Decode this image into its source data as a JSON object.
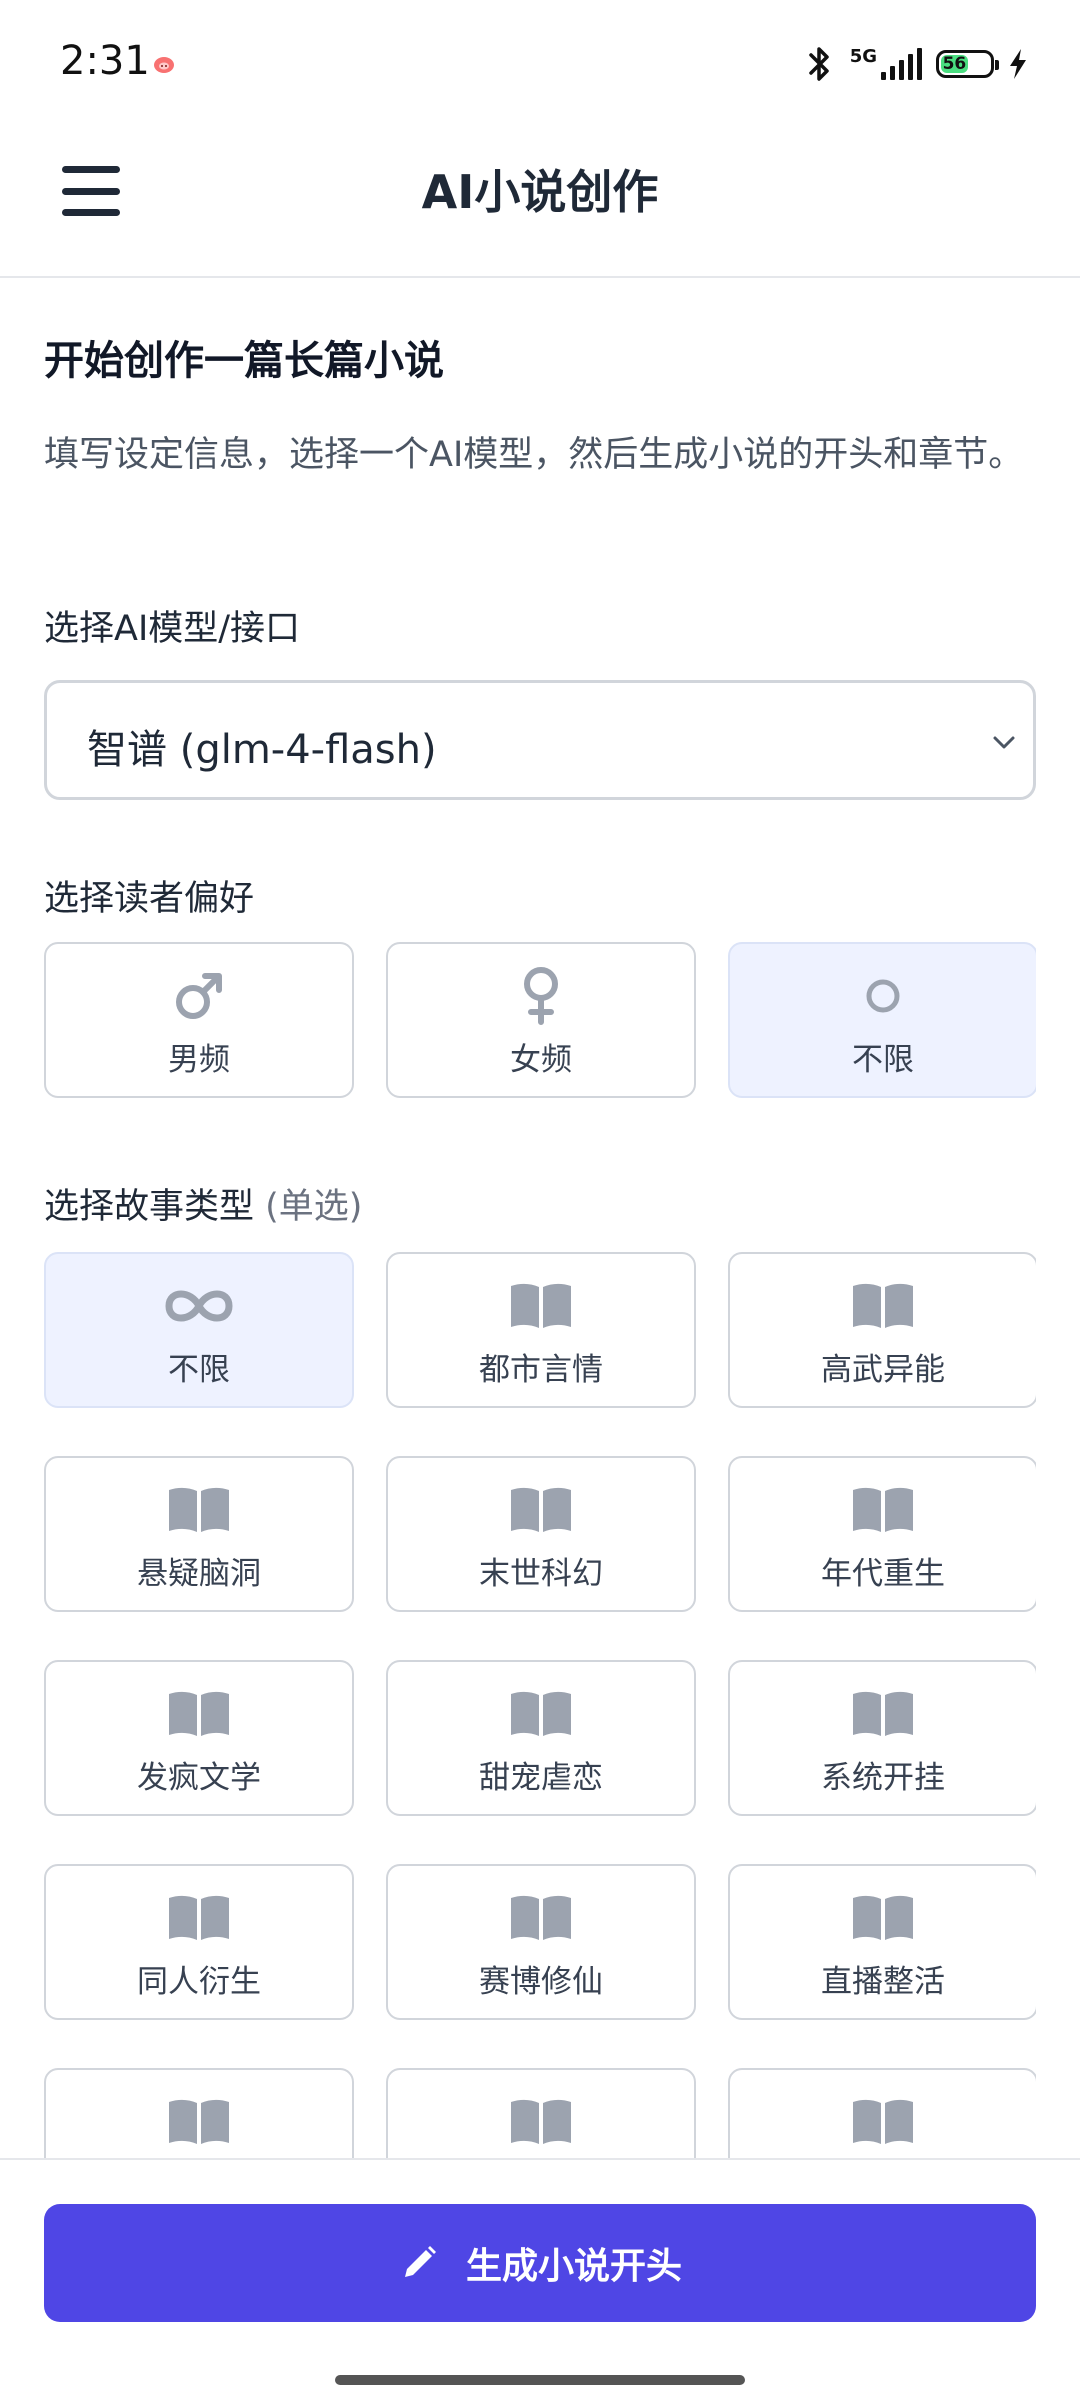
{
  "status_bar": {
    "time": "2:31",
    "network": "5G",
    "battery": "56",
    "battery_level": 0.56
  },
  "header": {
    "title": "AI小说创作",
    "menu_icon": "hamburger-menu-icon"
  },
  "intro": {
    "title": "开始创作一篇长篇小说",
    "description": "填写设定信息，选择一个AI模型，然后生成小说的开头和章节。"
  },
  "model": {
    "label": "选择AI模型/接口",
    "selected": "智谱 (glm-4-flash)"
  },
  "preference": {
    "label": "选择读者偏好",
    "options": [
      {
        "label": "男频",
        "icon": "male-symbol-icon",
        "selected": false
      },
      {
        "label": "女频",
        "icon": "female-symbol-icon",
        "selected": false
      },
      {
        "label": "不限",
        "icon": "circle-icon",
        "selected": true
      }
    ]
  },
  "genre": {
    "label": "选择故事类型",
    "hint": "(单选)",
    "options": [
      {
        "label": "不限",
        "icon": "infinity-icon",
        "selected": true
      },
      {
        "label": "都市言情",
        "icon": "book-icon",
        "selected": false
      },
      {
        "label": "高武异能",
        "icon": "book-icon",
        "selected": false
      },
      {
        "label": "悬疑脑洞",
        "icon": "book-icon",
        "selected": false
      },
      {
        "label": "末世科幻",
        "icon": "book-icon",
        "selected": false
      },
      {
        "label": "年代重生",
        "icon": "book-icon",
        "selected": false
      },
      {
        "label": "发疯文学",
        "icon": "book-icon",
        "selected": false
      },
      {
        "label": "甜宠虐恋",
        "icon": "book-icon",
        "selected": false
      },
      {
        "label": "系统开挂",
        "icon": "book-icon",
        "selected": false
      },
      {
        "label": "同人衍生",
        "icon": "book-icon",
        "selected": false
      },
      {
        "label": "赛博修仙",
        "icon": "book-icon",
        "selected": false
      },
      {
        "label": "直播整活",
        "icon": "book-icon",
        "selected": false
      },
      {
        "label": "",
        "icon": "book-icon",
        "selected": false
      },
      {
        "label": "",
        "icon": "book-icon",
        "selected": false
      },
      {
        "label": "",
        "icon": "book-icon",
        "selected": false
      }
    ]
  },
  "actions": {
    "generate_label": "生成小说开头",
    "generate_icon": "pencil-icon"
  },
  "colors": {
    "accent": "#4f46e5",
    "selected_bg": "#eef2ff",
    "icon_gray": "#9ca3af"
  }
}
